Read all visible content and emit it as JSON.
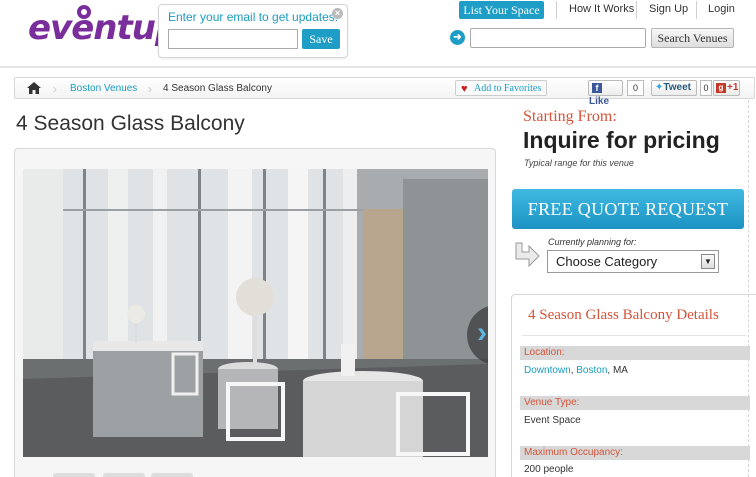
{
  "brand": {
    "logo_text": "eventup",
    "accent": "#1e9ec7",
    "logo_color": "#7a2e9c",
    "title_orange": "#d2543a"
  },
  "email_signup": {
    "prompt": "Enter your email to get updates!",
    "value": "",
    "save_label": "Save"
  },
  "top_nav": {
    "list_space_label": "List Your Space",
    "links": [
      "How It Works",
      "Sign Up",
      "Login"
    ]
  },
  "search": {
    "placeholder": "",
    "button_label": "Search Venues"
  },
  "breadcrumb": {
    "items": [
      "Boston Venues",
      "4 Season Glass Balcony"
    ]
  },
  "social": {
    "favorites_label": "Add to Favorites",
    "like_label": "Like",
    "like_count": "0",
    "tweet_label": "Tweet",
    "tweet_count": "0",
    "gplus_label": "+1"
  },
  "venue": {
    "title": "4 Season Glass Balcony"
  },
  "pricing": {
    "starting_from": "Starting From:",
    "price": "Inquire for pricing",
    "range_note": "Typical range for this venue"
  },
  "quote": {
    "button_label": "FREE QUOTE REQUEST"
  },
  "planning": {
    "label": "Currently planning for:",
    "selected": "Choose Category"
  },
  "details": {
    "title": "4 Season Glass Balcony Details",
    "location_label": "Location:",
    "location_neighborhood": "Downtown",
    "location_city": "Boston",
    "location_state": ", MA",
    "venue_type_label": "Venue Type:",
    "venue_type": "Event Space",
    "max_occupancy_label": "Maximum Occupancy:",
    "max_occupancy": "200 people"
  }
}
